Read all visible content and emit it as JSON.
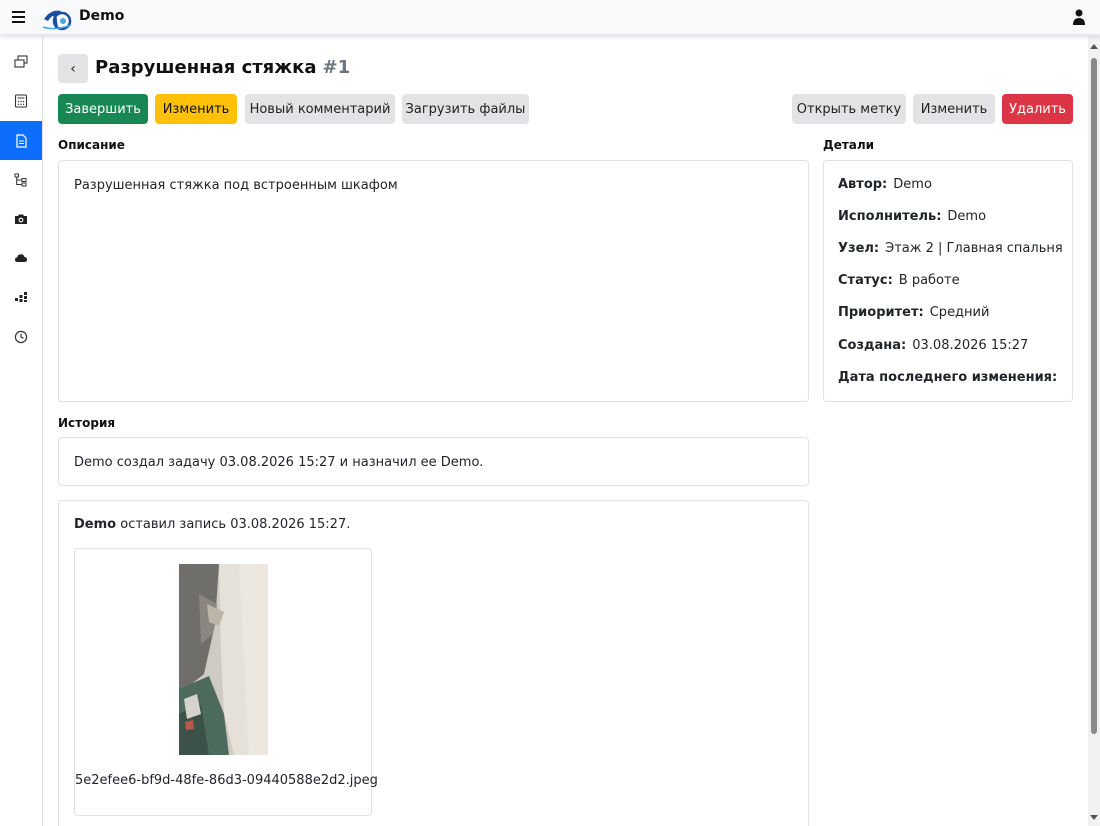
{
  "app": {
    "title": "Demo"
  },
  "header": {
    "title": "Разрушенная стяжка",
    "number": "#1"
  },
  "toolbar": {
    "complete": "Завершить",
    "edit": "Изменить",
    "new_comment": "Новый комментарий",
    "upload_files": "Загрузить файлы",
    "open_mark": "Открыть метку",
    "edit_right": "Изменить",
    "delete": "Удалить"
  },
  "description": {
    "label": "Описание",
    "text": "Разрушенная стяжка под встроенным шкафом"
  },
  "details": {
    "label": "Детали",
    "author_label": "Автор:",
    "author": "Demo",
    "assignee_label": "Исполнитель:",
    "assignee": "Demo",
    "node_label": "Узел:",
    "node": "Этаж 2 | Главная спальня",
    "status_label": "Статус:",
    "status": "В работе",
    "priority_label": "Приоритет:",
    "priority": "Средний",
    "created_label": "Создана:",
    "created": "03.08.2026 15:27",
    "modified_label": "Дата последнего изменения:",
    "modified": ""
  },
  "history": {
    "label": "История",
    "event": "Demo создал задачу 03.08.2026 15:27 и назначил ее Demo.",
    "entry_author": "Demo",
    "entry_text": "оставил запись 03.08.2026 15:27.",
    "file_name": "5e2efee6-bf9d-48fe-86d3-09440588e2d2.jpeg"
  },
  "colors": {
    "accent": "#0d6efd",
    "success": "#198754",
    "warning": "#ffc107",
    "danger": "#dc3545",
    "light": "#e2e3e5"
  },
  "icons": {
    "sidebar": [
      "layers-icon",
      "calculator-icon",
      "document-icon",
      "tree-icon",
      "camera-icon",
      "cloud-icon",
      "dashboard-icon",
      "clock-icon"
    ],
    "header": [
      "hamburger-icon",
      "logo-icon",
      "user-icon"
    ]
  }
}
